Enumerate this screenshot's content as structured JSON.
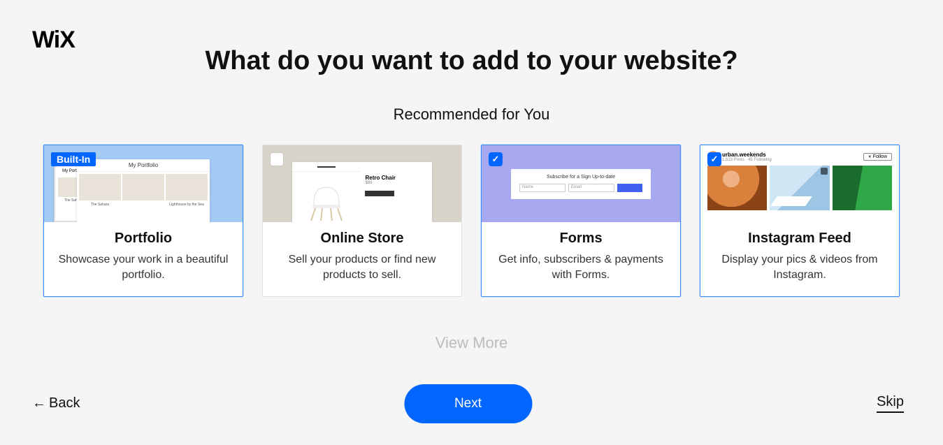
{
  "brand": "WiX",
  "heading": "What do you want to add to your website?",
  "subheading": "Recommended for You",
  "view_more": "View More",
  "cards": [
    {
      "title": "Portfolio",
      "desc": "Showcase your work in a beautiful portfolio.",
      "badge": "Built-In",
      "selected": true,
      "preview": {
        "site_title": "My Portfolio",
        "captions": [
          "The Sahara",
          "Lighthouse by the Sea"
        ]
      }
    },
    {
      "title": "Online Store",
      "desc": "Sell your products or find new products to sell.",
      "selected": false,
      "preview": {
        "product_title": "Retro Chair",
        "product_price": "$89"
      }
    },
    {
      "title": "Forms",
      "desc": "Get info, subscribers & payments with Forms.",
      "selected": true,
      "preview": {
        "form_title": "Subscribe for a Sign Up-to-date",
        "fields": [
          "Name",
          "Email"
        ]
      }
    },
    {
      "title": "Instagram Feed",
      "desc": "Display your pics & videos from Instagram.",
      "selected": true,
      "preview": {
        "account": "urban.weekends",
        "meta": "1,513 Posts · 45 Following",
        "follow_label": "Follow"
      }
    }
  ],
  "footer": {
    "back": "Back",
    "next": "Next",
    "skip": "Skip"
  }
}
